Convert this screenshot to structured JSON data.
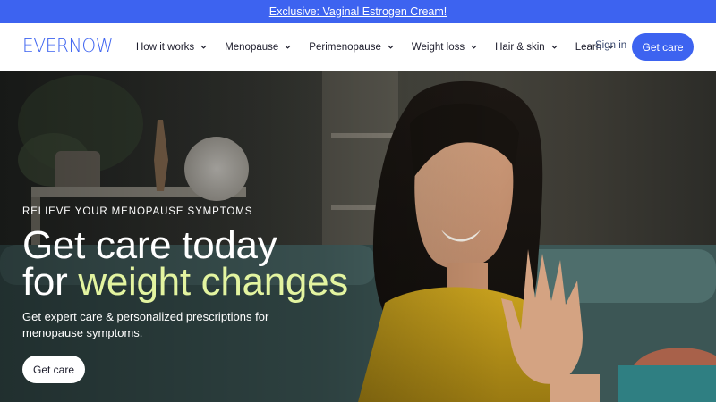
{
  "promo": {
    "text": "Exclusive: Vaginal Estrogen Cream!"
  },
  "brand": {
    "logo": "EVERNOW",
    "accent_color": "#3d63f0",
    "highlight_color": "#e3f4a0"
  },
  "nav": {
    "items": [
      {
        "label": "How it works",
        "icon": "chevron-down-icon"
      },
      {
        "label": "Menopause",
        "icon": "chevron-down-icon"
      },
      {
        "label": "Perimenopause",
        "icon": "chevron-down-icon"
      },
      {
        "label": "Weight loss",
        "icon": "chevron-down-icon"
      },
      {
        "label": "Hair & skin",
        "icon": "chevron-down-icon"
      },
      {
        "label": "Learn",
        "icon": "chevron-down-icon"
      }
    ],
    "sign_in": "Sign in",
    "cta": "Get care"
  },
  "hero": {
    "eyebrow": "RELIEVE YOUR MENOPAUSE SYMPTOMS",
    "headline_line1": "Get care today",
    "headline_line2_prefix": "for ",
    "headline_accent": "weight changes",
    "subtext": "Get expert care & personalized prescriptions for menopause symptoms.",
    "cta": "Get care"
  }
}
